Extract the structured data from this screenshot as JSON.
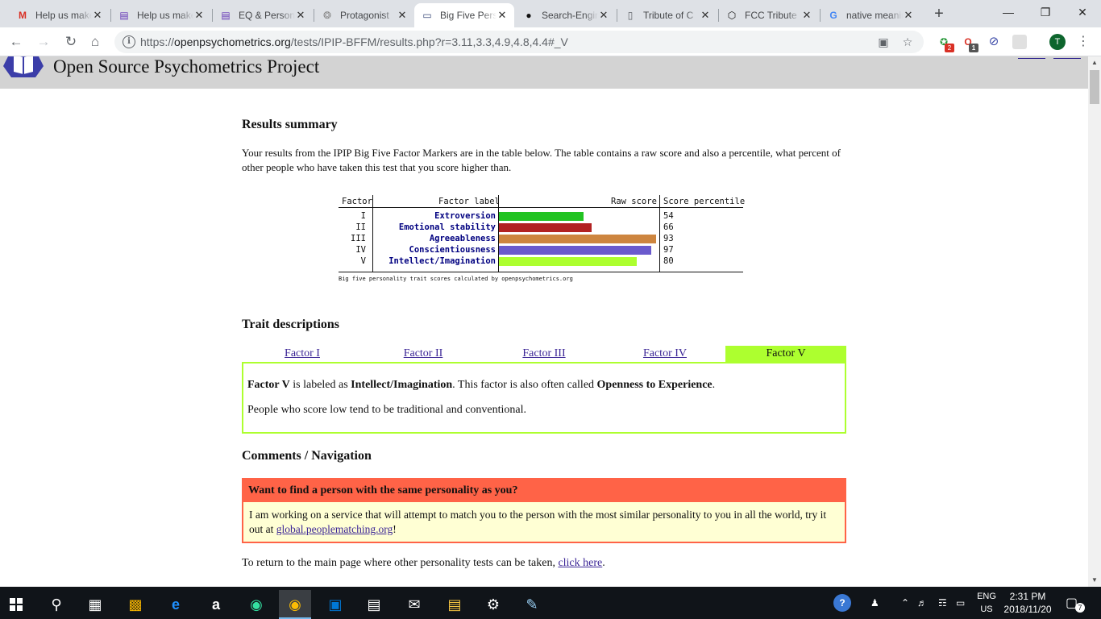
{
  "browser": {
    "tabs": [
      {
        "title": "Help us make",
        "favicon": "gmail-icon",
        "glyph": "M",
        "color": "#d93025",
        "active": false
      },
      {
        "title": "Help us make",
        "favicon": "forms-icon",
        "glyph": "▤",
        "color": "#673ab7",
        "active": false
      },
      {
        "title": "EQ & Personality",
        "favicon": "forms-icon",
        "glyph": "▤",
        "color": "#673ab7",
        "active": false
      },
      {
        "title": "Protagonist",
        "favicon": "globe-icon",
        "glyph": "❂",
        "color": "#888888",
        "active": false
      },
      {
        "title": "Big Five Personality",
        "favicon": "page-icon",
        "glyph": "▭",
        "color": "#3a4a7a",
        "active": true
      },
      {
        "title": "Search-Engine",
        "favicon": "github-icon",
        "glyph": "●",
        "color": "#111111",
        "active": false
      },
      {
        "title": "Tribute of C",
        "favicon": "document-icon",
        "glyph": "▯",
        "color": "#5f6368",
        "active": false
      },
      {
        "title": "FCC Tribute",
        "favicon": "codepen-icon",
        "glyph": "⬡",
        "color": "#111111",
        "active": false
      },
      {
        "title": "native meaning",
        "favicon": "google-icon",
        "glyph": "G",
        "color": "#4285f4",
        "active": false
      }
    ],
    "url_scheme": "https://",
    "url_host": "openpsychometrics.org",
    "url_path": "/tests/IPIP-BFFM/results.php?r=3.11,3.3,4.9,4.8,4.4#_V",
    "ext_badge_1": "2",
    "ext_badge_2": "1",
    "avatar_letter": "T"
  },
  "site": {
    "title": "Open Source Psychometrics Project"
  },
  "results": {
    "heading": "Results summary",
    "intro": "Your results from the IPIP Big Five Factor Markers are in the table below. The table contains a raw score and also a percentile, what percent of other people who have taken this test that you score higher than.",
    "col_factor": "Factor",
    "col_label": "Factor label",
    "col_raw": "Raw score",
    "col_pct": "Score percentile",
    "caption": "Big five personality trait scores calculated by openpsychometrics.org"
  },
  "chart_data": {
    "type": "bar",
    "categories": [
      "Extroversion",
      "Emotional stability",
      "Agreeableness",
      "Conscientiousness",
      "Intellect/Imagination"
    ],
    "factors": [
      "I",
      "II",
      "III",
      "IV",
      "V"
    ],
    "values": [
      54,
      66,
      93,
      97,
      80
    ],
    "raw_scores_fraction": [
      0.53,
      0.58,
      0.98,
      0.95,
      0.86
    ],
    "colors": [
      "#22c322",
      "#b22222",
      "#cd853f",
      "#6a5acd",
      "#adff2f"
    ],
    "xlabel": "Raw score",
    "ylabel": "Factor label"
  },
  "traits": {
    "heading": "Trait descriptions",
    "tabs": [
      "Factor I",
      "Factor II",
      "Factor III",
      "Factor IV",
      "Factor V"
    ],
    "selected_index": 4,
    "selected_color": "#adff2f",
    "panel_factor": "Factor V",
    "panel_mid1": " is labeled as ",
    "panel_label": "Intellect/Imagination",
    "panel_mid2": ". This factor is also often called ",
    "panel_alt": "Openness to Experience",
    "panel_end": ".",
    "panel_low": "People who score low tend to be traditional and conventional."
  },
  "comments": {
    "heading": "Comments / Navigation",
    "notice_head": "Want to find a person with the same personality as you?",
    "notice_body": "I am working on a service that will attempt to match you to the person with the most similar personality to you in all the world, try it out at ",
    "notice_link": "global.peoplematching.org",
    "notice_end": "!",
    "return_text": "To return to the main page where other personality tests can be taken, ",
    "return_link": "click here",
    "return_end": "."
  },
  "taskbar": {
    "lang": "ENG",
    "region": "US",
    "time": "2:31 PM",
    "date": "2018/11/20",
    "notif_count": "7"
  }
}
